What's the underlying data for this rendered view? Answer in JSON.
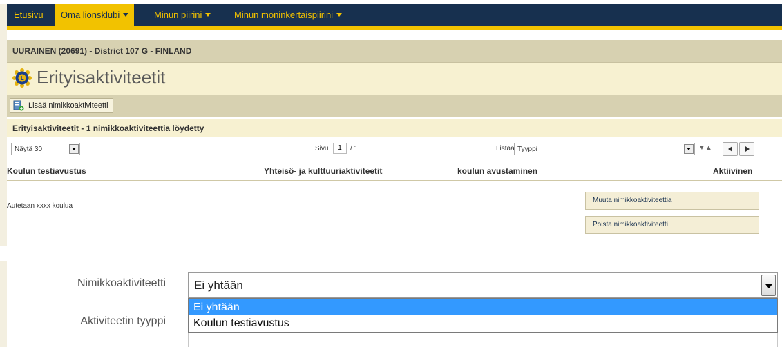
{
  "nav": {
    "items": [
      {
        "label": "Etusivu"
      },
      {
        "label": "Oma lionsklubi"
      },
      {
        "label": "Minun piirini"
      },
      {
        "label": "Minun moninkertaispiirini"
      }
    ]
  },
  "club_header": "UURAINEN (20691) - District 107 G - FINLAND",
  "page_title": "Erityisaktiviteetit",
  "toolbar": {
    "add_label": "Lisää nimikkoaktiviteetti"
  },
  "results_summary": "Erityisaktiviteetit - 1 nimikkoaktiviteettia löydetty",
  "pager": {
    "show_value": "Näytä 30",
    "page_label": "Sivu",
    "page_value": "1",
    "page_total": "/ 1",
    "list_label": "Listaa",
    "list_value": "Tyyppi"
  },
  "table": {
    "columns": [
      "Koulun testiavustus",
      "Yhteisö- ja kulttuuriaktiviteetit",
      "koulun avustaminen",
      "Aktiivinen"
    ],
    "rows": [
      {
        "description": "Autetaan xxxx koulua",
        "edit_label": "Muuta nimikkoaktiviteettia",
        "delete_label": "Poista nimikkoaktiviteetti"
      }
    ]
  },
  "form": {
    "activity_label": "Nimikkoaktiviteetti",
    "activity_value": "Ei yhtään",
    "type_label": "Aktiviteetin tyyppi",
    "options": [
      "Ei yhtään",
      "Koulun testiavustus"
    ]
  },
  "colors": {
    "nav_bg": "#17304f",
    "accent": "#f2c200",
    "band": "#d7d1b1",
    "light_band": "#f7f1d1",
    "selected_option": "#3399ff"
  }
}
